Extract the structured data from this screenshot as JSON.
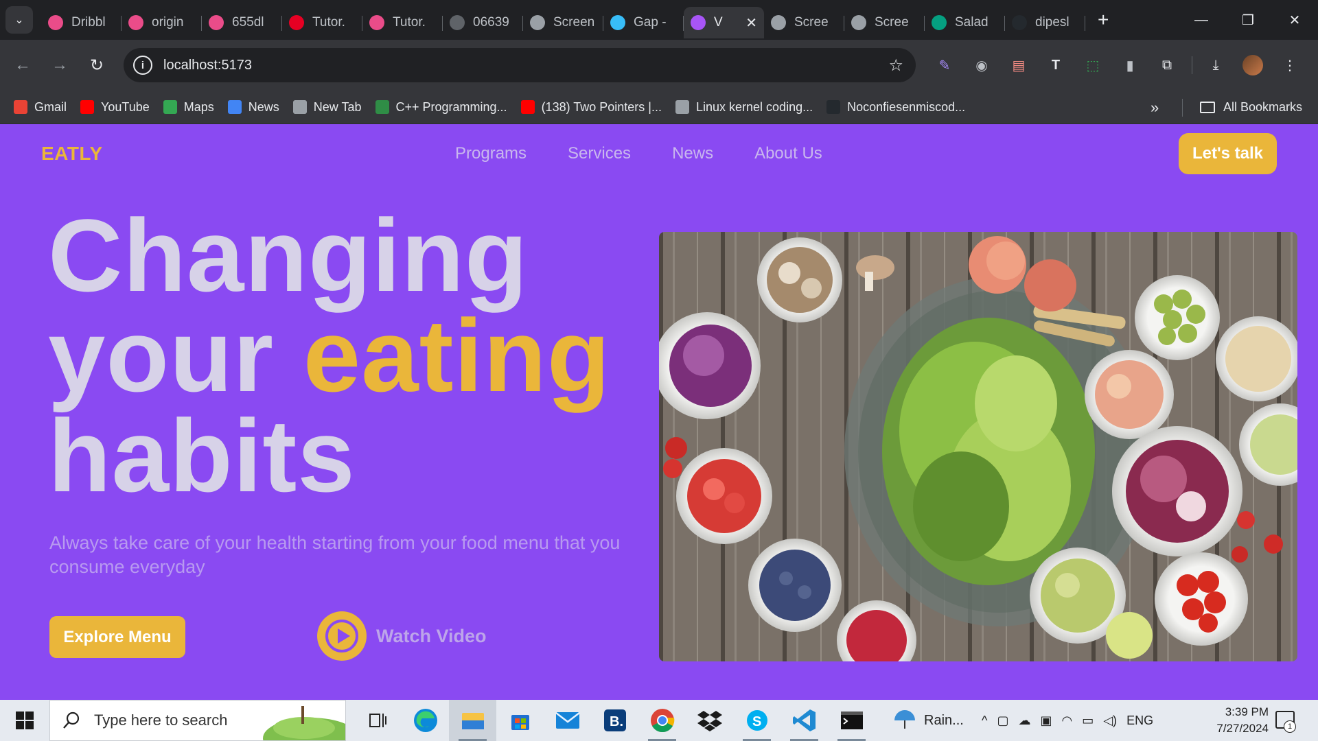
{
  "browser": {
    "tabs": [
      {
        "title": "Dribbl",
        "icon": "dribbble-icon",
        "color": "#ea4c89"
      },
      {
        "title": "origin",
        "icon": "dribbble-icon",
        "color": "#ea4c89"
      },
      {
        "title": "655dl",
        "icon": "dribbble-icon",
        "color": "#ea4c89"
      },
      {
        "title": "Tutor.",
        "icon": "pinterest-icon",
        "color": "#e60023"
      },
      {
        "title": "Tutor.",
        "icon": "dribbble-icon",
        "color": "#ea4c89"
      },
      {
        "title": "06639",
        "icon": "globe-icon",
        "color": "#5f6368"
      },
      {
        "title": "Screen",
        "icon": "camera-icon",
        "color": "#9aa0a6"
      },
      {
        "title": "Gap -",
        "icon": "tailwind-icon",
        "color": "#38bdf8"
      },
      {
        "title": "V",
        "icon": "vite-icon",
        "color": "#a855f7",
        "active": true
      },
      {
        "title": "Scree",
        "icon": "camera-icon",
        "color": "#9aa0a6"
      },
      {
        "title": "Scree",
        "icon": "camera-icon",
        "color": "#9aa0a6"
      },
      {
        "title": "Salad",
        "icon": "pexels-icon",
        "color": "#05a081"
      },
      {
        "title": "dipesl",
        "icon": "github-icon",
        "color": "#24292e"
      }
    ],
    "url": "localhost:5173",
    "bookmarks": [
      {
        "label": "Gmail",
        "icon": "gmail-icon",
        "color": "#ea4335"
      },
      {
        "label": "YouTube",
        "icon": "youtube-icon",
        "color": "#ff0000"
      },
      {
        "label": "Maps",
        "icon": "maps-icon",
        "color": "#34a853"
      },
      {
        "label": "News",
        "icon": "news-icon",
        "color": "#4285f4"
      },
      {
        "label": "New Tab",
        "icon": "globe-icon",
        "color": "#9aa0a6"
      },
      {
        "label": "C++ Programming...",
        "icon": "gfg-icon",
        "color": "#2f8d46"
      },
      {
        "label": "(138) Two Pointers |...",
        "icon": "youtube-icon",
        "color": "#ff0000"
      },
      {
        "label": "Linux kernel coding...",
        "icon": "globe-icon",
        "color": "#9aa0a6"
      },
      {
        "label": "Noconfiesenmiscod...",
        "icon": "github-icon",
        "color": "#24292e"
      }
    ],
    "all_bookmarks": "All Bookmarks"
  },
  "site": {
    "logo": "EATLY",
    "nav": [
      "Programs",
      "Services",
      "News",
      "About Us"
    ],
    "cta": "Let's talk",
    "hero": {
      "line1": "Changing",
      "line2_plain": "your ",
      "line2_accent": "eating",
      "line3": "habits",
      "subtitle": "Always take care of your health starting from your food menu that you consume everyday",
      "explore": "Explore Menu",
      "watch": "Watch Video"
    },
    "colors": {
      "background": "#8a4af2",
      "accent": "#eab63a",
      "title": "#d7d2e8"
    }
  },
  "taskbar": {
    "search_placeholder": "Type here to search",
    "weather": "Rain...",
    "language": "ENG",
    "time": "3:39 PM",
    "date": "7/27/2024",
    "notifications": "1"
  }
}
